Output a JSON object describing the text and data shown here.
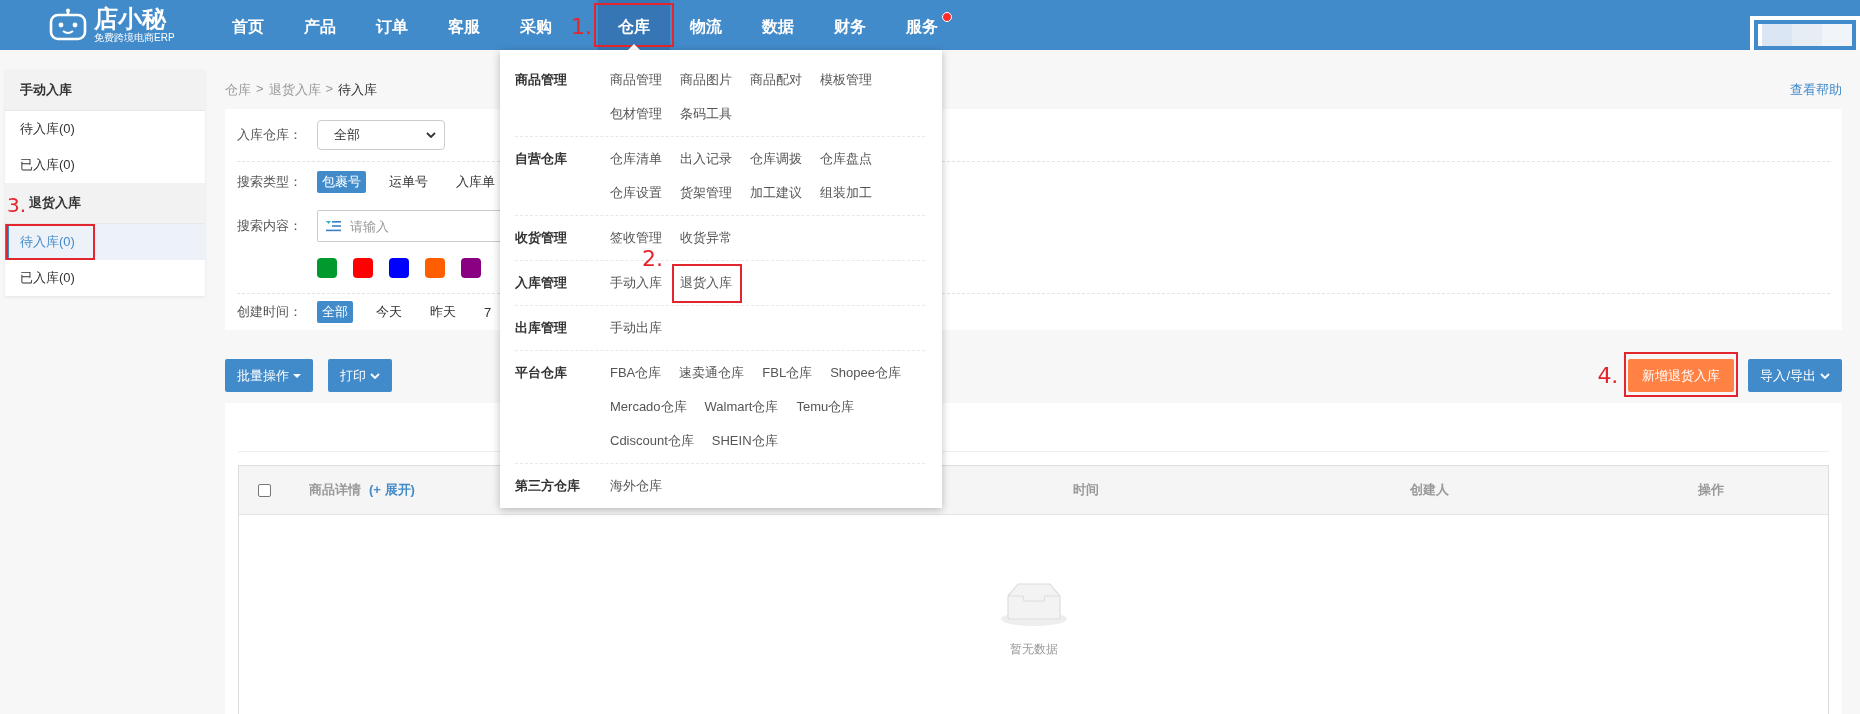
{
  "header": {
    "logo": {
      "name": "店小秘",
      "tagline": "免费跨境电商ERP"
    },
    "nav": [
      {
        "label": "首页",
        "selected": false,
        "notify": false
      },
      {
        "label": "产品",
        "selected": false,
        "notify": false
      },
      {
        "label": "订单",
        "selected": false,
        "notify": false
      },
      {
        "label": "客服",
        "selected": false,
        "notify": false
      },
      {
        "label": "采购",
        "selected": false,
        "notify": false
      },
      {
        "label": "仓库",
        "selected": true,
        "notify": false,
        "expanded": true,
        "callout": "1."
      },
      {
        "label": "物流",
        "selected": false,
        "notify": false
      },
      {
        "label": "数据",
        "selected": false,
        "notify": false
      },
      {
        "label": "财务",
        "selected": false,
        "notify": false
      },
      {
        "label": "服务",
        "selected": false,
        "notify": true
      }
    ]
  },
  "sidebar": {
    "groups": [
      {
        "title": "手动入库",
        "items": [
          {
            "label": "待入库(0)",
            "selected": false
          },
          {
            "label": "已入库(0)",
            "selected": false
          }
        ]
      },
      {
        "title": "退货入库",
        "items": [
          {
            "label": "待入库(0)",
            "selected": true,
            "callout": "3."
          },
          {
            "label": "已入库(0)",
            "selected": false
          }
        ]
      }
    ]
  },
  "breadcrumb": {
    "separator": ">",
    "items": [
      "仓库",
      "退货入库",
      "待入库"
    ]
  },
  "help_link": "查看帮助",
  "filters": {
    "warehouse": {
      "label": "入库仓库：",
      "value": "全部"
    },
    "search_type": {
      "label": "搜索类型：",
      "options": [
        {
          "label": "包裹号",
          "selected": true
        },
        {
          "label": "运单号",
          "selected": false
        },
        {
          "label": "入库单",
          "selected": false
        }
      ]
    },
    "search_content": {
      "label": "搜索内容：",
      "placeholder": "请输入",
      "colors": [
        {
          "color": "#009a2e"
        },
        {
          "color": "#ff0000"
        },
        {
          "color": "#0000ff"
        },
        {
          "color": "#ff5e00"
        },
        {
          "color": "#8a0082"
        }
      ]
    },
    "created": {
      "label": "创建时间：",
      "options": [
        {
          "label": "全部",
          "selected": true
        },
        {
          "label": "今天",
          "selected": false
        },
        {
          "label": "昨天",
          "selected": false
        },
        {
          "label": "7",
          "selected": false
        }
      ]
    }
  },
  "toolbar": {
    "left": [
      {
        "label": "批量操作",
        "kind": "menu"
      },
      {
        "label": "打印",
        "kind": "dropdown"
      }
    ],
    "right": [
      {
        "label": "新增退货入库",
        "kind": "accent",
        "callout": "4."
      },
      {
        "label": "导入/导出",
        "kind": "dropdown"
      }
    ]
  },
  "table": {
    "columns": [
      {
        "kind": "checkbox",
        "checked": false
      },
      {
        "kind": "text",
        "label": "商品详情",
        "extra": "(+ 展开)"
      },
      {
        "kind": "text",
        "label": "时间"
      },
      {
        "kind": "text",
        "label": "创建人"
      },
      {
        "kind": "text",
        "label": "操作"
      }
    ],
    "empty_text": "暂无数据"
  },
  "menu": {
    "groups": [
      {
        "title": "商品管理",
        "links": [
          {
            "label": "商品管理"
          },
          {
            "label": "商品图片"
          },
          {
            "label": "商品配对"
          },
          {
            "label": "模板管理"
          },
          {
            "label": "包材管理"
          },
          {
            "label": "条码工具"
          }
        ]
      },
      {
        "title": "自营仓库",
        "links": [
          {
            "label": "仓库清单"
          },
          {
            "label": "出入记录"
          },
          {
            "label": "仓库调拨"
          },
          {
            "label": "仓库盘点"
          },
          {
            "label": "仓库设置"
          },
          {
            "label": "货架管理"
          },
          {
            "label": "加工建议"
          },
          {
            "label": "组装加工"
          }
        ]
      },
      {
        "title": "收货管理",
        "links": [
          {
            "label": "签收管理"
          },
          {
            "label": "收货异常"
          }
        ]
      },
      {
        "title": "入库管理",
        "links": [
          {
            "label": "手动入库"
          },
          {
            "label": "退货入库",
            "callout": "2."
          }
        ]
      },
      {
        "title": "出库管理",
        "links": [
          {
            "label": "手动出库"
          }
        ]
      },
      {
        "title": "平台仓库",
        "links": [
          {
            "label": "FBA仓库"
          },
          {
            "label": "速卖通仓库"
          },
          {
            "label": "FBL仓库"
          },
          {
            "label": "Shopee仓库"
          },
          {
            "label": "Mercado仓库"
          },
          {
            "label": "Walmart仓库"
          },
          {
            "label": "Temu仓库"
          },
          {
            "label": "Cdiscount仓库"
          },
          {
            "label": "SHEIN仓库"
          }
        ]
      },
      {
        "title": "第三方仓库",
        "links": [
          {
            "label": "海外仓库"
          }
        ]
      }
    ]
  }
}
